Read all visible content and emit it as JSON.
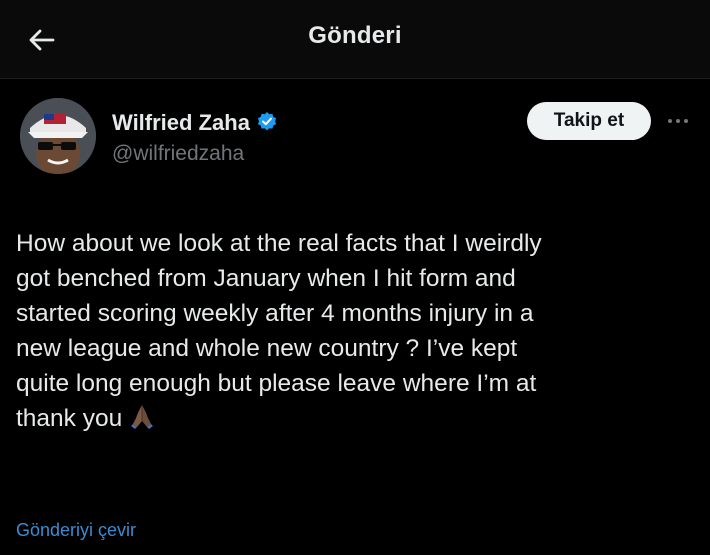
{
  "header": {
    "title": "Gönderi",
    "back_icon": "arrow-left-icon"
  },
  "author": {
    "name": "Wilfried Zaha",
    "handle": "@wilfriedzaha",
    "verified_icon": "verified-badge-icon",
    "verified_color": "#1d9bf0"
  },
  "actions": {
    "follow_label": "Takip et",
    "more_icon": "more-horizontal-icon"
  },
  "tweet": {
    "text": "How about we look at the real facts that I weirdly\ngot benched from January when I hit form and\nstarted scoring weekly after 4 months injury in a\nnew league and whole new country ? I’ve kept\nquite long enough but please leave where I’m at\nthank you",
    "emoji_icon": "folded-hands-icon"
  },
  "footer": {
    "translate_label": "Gönderiyi çevir",
    "link_color": "#3b8bd0"
  },
  "colors": {
    "background": "#000000",
    "text": "#e7e9ea",
    "muted": "#71767b"
  }
}
